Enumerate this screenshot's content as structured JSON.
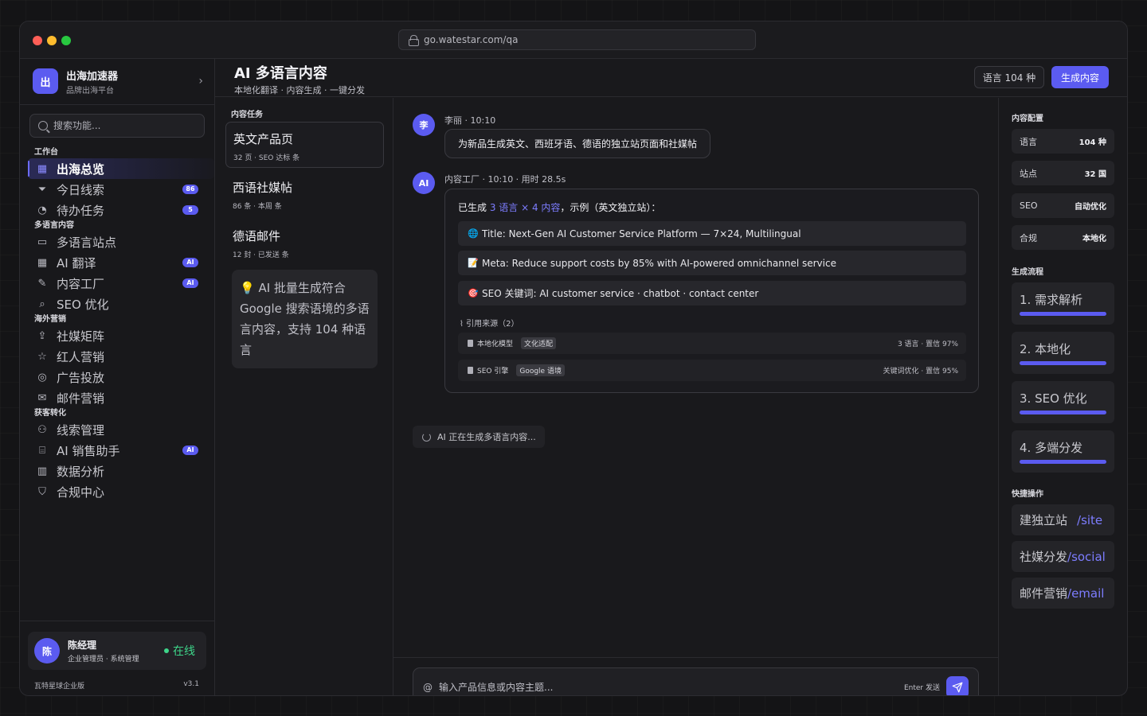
{
  "browser": {
    "url": "go.watestar.com/qa"
  },
  "brand": {
    "logo": "出",
    "name": "出海加速器",
    "subtitle": "品牌出海平台"
  },
  "search": {
    "placeholder": "搜索功能..."
  },
  "sidebar": {
    "sections": [
      {
        "title": "工作台",
        "items": [
          {
            "label": "出海总览",
            "icon": "grid-icon",
            "active": true
          },
          {
            "label": "今日线索",
            "icon": "filter-icon",
            "badge": "86"
          },
          {
            "label": "待办任务",
            "icon": "check-circle-icon",
            "badge": "5"
          }
        ]
      },
      {
        "title": "多语言内容",
        "items": [
          {
            "label": "多语言站点",
            "icon": "monitor-icon"
          },
          {
            "label": "AI 翻译",
            "icon": "grid-icon",
            "badge": "AI"
          },
          {
            "label": "内容工厂",
            "icon": "pencil-icon",
            "badge": "AI"
          },
          {
            "label": "SEO 优化",
            "icon": "search-icon"
          }
        ]
      },
      {
        "title": "海外营销",
        "items": [
          {
            "label": "社媒矩阵",
            "icon": "share-icon"
          },
          {
            "label": "红人营销",
            "icon": "star-icon"
          },
          {
            "label": "广告投放",
            "icon": "target-icon"
          },
          {
            "label": "邮件营销",
            "icon": "mail-icon"
          }
        ]
      },
      {
        "title": "获客转化",
        "items": [
          {
            "label": "线索管理",
            "icon": "users-icon"
          },
          {
            "label": "AI 销售助手",
            "icon": "bot-icon",
            "badge": "AI"
          },
          {
            "label": "数据分析",
            "icon": "bar-chart-icon"
          },
          {
            "label": "合规中心",
            "icon": "shield-icon"
          }
        ]
      }
    ]
  },
  "user": {
    "avatar": "陈",
    "name": "陈经理",
    "role": "企业管理员 · 系统管理",
    "status": "在线"
  },
  "footer": {
    "edition": "瓦特星球企业版",
    "version": "v3.1"
  },
  "header": {
    "title": "AI 多语言内容",
    "subtitle": "本地化翻译 · 内容生成 · 一键分发",
    "lang_button": "语言 104 种",
    "generate_button": "生成内容"
  },
  "tasks": {
    "label": "内容任务",
    "items": [
      {
        "title": "英文产品页",
        "meta": "32 页 · SEO 达标 条",
        "selected": true
      },
      {
        "title": "西语社媒帖",
        "meta": "86 条 · 本周 条"
      },
      {
        "title": "德语邮件",
        "meta": "12 封 · 已发送 条"
      }
    ],
    "tip_icon": "💡",
    "tip": "AI 批量生成符合 Google 搜索语境的多语言内容，支持 104 种语言"
  },
  "chat": {
    "user_msg": {
      "avatar": "李",
      "meta": "李丽 · 10:10",
      "text": "为新品生成英文、西班牙语、德语的独立站页面和社媒帖"
    },
    "ai_msg": {
      "avatar": "AI",
      "meta": "内容工厂 · 10:10 · 用时 28.5s",
      "headline_pre": "已生成 ",
      "headline_accent": "3 语言 × 4 内容",
      "headline_post": "，示例（英文独立站）：",
      "results": [
        {
          "icon": "🌐",
          "text": "Title: Next-Gen AI Customer Service Platform — 7×24, Multilingual"
        },
        {
          "icon": "📝",
          "text": "Meta: Reduce support costs by 85% with AI-powered omnichannel service"
        },
        {
          "icon": "🎯",
          "text": "SEO 关键词: AI customer service · chatbot · contact center"
        }
      ],
      "sources_label": "引用来源（2）",
      "sources": [
        {
          "name": "本地化模型",
          "tag": "文化适配",
          "stat": "3 语言 · 置信 97%"
        },
        {
          "name": "SEO 引擎",
          "tag": "Google 语境",
          "stat": "关键词优化 · 置信 95%"
        }
      ]
    },
    "generating": "AI 正在生成多语言内容...",
    "composer": {
      "placeholder": "输入产品信息或内容主题...",
      "hint": "Enter 发送"
    }
  },
  "config": {
    "label": "内容配置",
    "rows": [
      {
        "key": "语言",
        "value": "104 种"
      },
      {
        "key": "站点",
        "value": "32 国"
      },
      {
        "key": "SEO",
        "value": "自动优化"
      },
      {
        "key": "合规",
        "value": "本地化"
      }
    ]
  },
  "flow": {
    "label": "生成流程",
    "steps": [
      {
        "label": "1. 需求解析",
        "progress": 1.0
      },
      {
        "label": "2. 本地化",
        "progress": 1.0
      },
      {
        "label": "3. SEO 优化",
        "progress": 1.0
      },
      {
        "label": "4. 多端分发",
        "progress": 1.0
      }
    ]
  },
  "quick": {
    "label": "快捷操作",
    "items": [
      {
        "label": "建独立站",
        "cmd": "/site"
      },
      {
        "label": "社媒分发",
        "cmd": "/social"
      },
      {
        "label": "邮件营销",
        "cmd": "/email"
      }
    ]
  },
  "colors": {
    "accent": "#5b5bf0",
    "online": "#3ed68a"
  }
}
